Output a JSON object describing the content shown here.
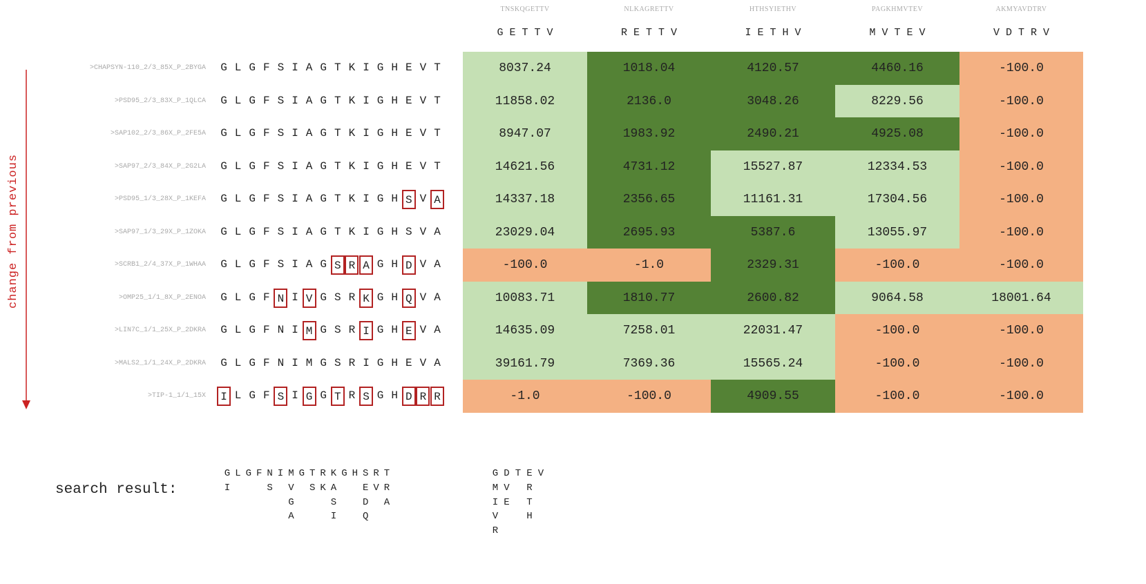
{
  "columns": [
    {
      "peptide": "TNSKQGETTV",
      "short": "G E T T V"
    },
    {
      "peptide": "NLKAGRETTV",
      "short": "R E T T V"
    },
    {
      "peptide": "HTHSYIETHV",
      "short": "I E T H V"
    },
    {
      "peptide": "PAGKHMVTEV",
      "short": "M V T E V"
    },
    {
      "peptide": "AKMYAVDTRV",
      "short": "V D T R V"
    }
  ],
  "rows": [
    {
      "label": ">CHAPSYN-110_2/3_85X_P_2BYGA",
      "sequence": [
        "G",
        "L",
        "G",
        "F",
        "S",
        "I",
        "A",
        "G",
        "T",
        "K",
        "I",
        "G",
        "H",
        "E",
        "V",
        "T"
      ],
      "changed": [],
      "values": [
        "8037.24",
        "1018.04",
        "4120.57",
        "4460.16",
        "-100.0"
      ],
      "classes": [
        "light",
        "dark",
        "dark",
        "dark",
        "neg"
      ]
    },
    {
      "label": ">PSD95_2/3_83X_P_1QLCA",
      "sequence": [
        "G",
        "L",
        "G",
        "F",
        "S",
        "I",
        "A",
        "G",
        "T",
        "K",
        "I",
        "G",
        "H",
        "E",
        "V",
        "T"
      ],
      "changed": [],
      "values": [
        "11858.02",
        "2136.0",
        "3048.26",
        "8229.56",
        "-100.0"
      ],
      "classes": [
        "light",
        "dark",
        "dark",
        "light",
        "neg"
      ]
    },
    {
      "label": ">SAP102_2/3_86X_P_2FE5A",
      "sequence": [
        "G",
        "L",
        "G",
        "F",
        "S",
        "I",
        "A",
        "G",
        "T",
        "K",
        "I",
        "G",
        "H",
        "E",
        "V",
        "T"
      ],
      "changed": [],
      "values": [
        "8947.07",
        "1983.92",
        "2490.21",
        "4925.08",
        "-100.0"
      ],
      "classes": [
        "light",
        "dark",
        "dark",
        "dark",
        "neg"
      ]
    },
    {
      "label": ">SAP97_2/3_84X_P_2G2LA",
      "sequence": [
        "G",
        "L",
        "G",
        "F",
        "S",
        "I",
        "A",
        "G",
        "T",
        "K",
        "I",
        "G",
        "H",
        "E",
        "V",
        "T"
      ],
      "changed": [],
      "values": [
        "14621.56",
        "4731.12",
        "15527.87",
        "12334.53",
        "-100.0"
      ],
      "classes": [
        "light",
        "dark",
        "light",
        "light",
        "neg"
      ]
    },
    {
      "label": ">PSD95_1/3_28X_P_1KEFA",
      "sequence": [
        "G",
        "L",
        "G",
        "F",
        "S",
        "I",
        "A",
        "G",
        "T",
        "K",
        "I",
        "G",
        "H",
        "S",
        "V",
        "A"
      ],
      "changed": [
        13,
        15
      ],
      "values": [
        "14337.18",
        "2356.65",
        "11161.31",
        "17304.56",
        "-100.0"
      ],
      "classes": [
        "light",
        "dark",
        "light",
        "light",
        "neg"
      ]
    },
    {
      "label": ">SAP97_1/3_29X_P_1ZOKA",
      "sequence": [
        "G",
        "L",
        "G",
        "F",
        "S",
        "I",
        "A",
        "G",
        "T",
        "K",
        "I",
        "G",
        "H",
        "S",
        "V",
        "A"
      ],
      "changed": [],
      "values": [
        "23029.04",
        "2695.93",
        "5387.6",
        "13055.97",
        "-100.0"
      ],
      "classes": [
        "light",
        "dark",
        "dark",
        "light",
        "neg"
      ]
    },
    {
      "label": ">SCRB1_2/4_37X_P_1WHAA",
      "sequence": [
        "G",
        "L",
        "G",
        "F",
        "S",
        "I",
        "A",
        "G",
        "S",
        "R",
        "A",
        "G",
        "H",
        "D",
        "V",
        "A"
      ],
      "changed": [
        8,
        9,
        10,
        13
      ],
      "values": [
        "-100.0",
        "-1.0",
        "2329.31",
        "-100.0",
        "-100.0"
      ],
      "classes": [
        "neg",
        "neg",
        "dark",
        "neg",
        "neg"
      ]
    },
    {
      "label": ">OMP25_1/1_8X_P_2ENOA",
      "sequence": [
        "G",
        "L",
        "G",
        "F",
        "N",
        "I",
        "V",
        "G",
        "S",
        "R",
        "K",
        "G",
        "H",
        "Q",
        "V",
        "A"
      ],
      "changed": [
        4,
        6,
        10,
        13
      ],
      "values": [
        "10083.71",
        "1810.77",
        "2600.82",
        "9064.58",
        "18001.64"
      ],
      "classes": [
        "light",
        "dark",
        "dark",
        "light",
        "light"
      ]
    },
    {
      "label": ">LIN7C_1/1_25X_P_2DKRA",
      "sequence": [
        "G",
        "L",
        "G",
        "F",
        "N",
        "I",
        "M",
        "G",
        "S",
        "R",
        "I",
        "G",
        "H",
        "E",
        "V",
        "A"
      ],
      "changed": [
        6,
        10,
        13
      ],
      "values": [
        "14635.09",
        "7258.01",
        "22031.47",
        "-100.0",
        "-100.0"
      ],
      "classes": [
        "light",
        "light",
        "light",
        "neg",
        "neg"
      ]
    },
    {
      "label": ">MALS2_1/1_24X_P_2DKRA",
      "sequence": [
        "G",
        "L",
        "G",
        "F",
        "N",
        "I",
        "M",
        "G",
        "S",
        "R",
        "I",
        "G",
        "H",
        "E",
        "V",
        "A"
      ],
      "changed": [],
      "values": [
        "39161.79",
        "7369.36",
        "15565.24",
        "-100.0",
        "-100.0"
      ],
      "classes": [
        "light",
        "light",
        "light",
        "neg",
        "neg"
      ]
    },
    {
      "label": ">TIP-1_1/1_15X",
      "sequence": [
        "I",
        "L",
        "G",
        "F",
        "S",
        "I",
        "G",
        "G",
        "T",
        "R",
        "S",
        "G",
        "H",
        "D",
        "R",
        "R"
      ],
      "changed": [
        0,
        4,
        6,
        8,
        10,
        13,
        14,
        15
      ],
      "values": [
        "-1.0",
        "-100.0",
        "4909.55",
        "-100.0",
        "-100.0"
      ],
      "classes": [
        "neg",
        "neg",
        "dark",
        "neg",
        "neg"
      ]
    }
  ],
  "colors": {
    "light": "#c5e0b4",
    "dark": "#548235",
    "neg": "#f4b183",
    "box": "#b22222",
    "axis": "#cc2222"
  },
  "axis_label": "change from previous",
  "search_label": "search result:",
  "search_domain": [
    [
      "G",
      "I"
    ],
    [
      "L"
    ],
    [
      "G"
    ],
    [
      "F"
    ],
    [
      "N",
      "S"
    ],
    [
      "I"
    ],
    [
      "M",
      "V",
      "G",
      "A"
    ],
    [
      "G"
    ],
    [
      "T",
      "S"
    ],
    [
      "R",
      "K"
    ],
    [
      "K",
      "A",
      "S",
      "I"
    ],
    [
      "G"
    ],
    [
      "H"
    ],
    [
      "S",
      "E",
      "D",
      "Q"
    ],
    [
      "R",
      "V"
    ],
    [
      "T",
      "R",
      "A"
    ]
  ],
  "search_peptide": [
    [
      "G",
      "M",
      "I",
      "V",
      "R"
    ],
    [
      "D",
      "V",
      "E"
    ],
    [
      "T"
    ],
    [
      "E",
      "R",
      "T",
      "H"
    ],
    [
      "V"
    ]
  ],
  "chart_data": {
    "type": "heatmap",
    "x": [
      "TNSKQGETTV",
      "NLKAGRETTV",
      "HTHSYIETHV",
      "PAGKHMVTEV",
      "AKMYAVDTRV"
    ],
    "y": [
      ">CHAPSYN-110_2/3_85X_P_2BYGA",
      ">PSD95_2/3_83X_P_1QLCA",
      ">SAP102_2/3_86X_P_2FE5A",
      ">SAP97_2/3_84X_P_2G2LA",
      ">PSD95_1/3_28X_P_1KEFA",
      ">SAP97_1/3_29X_P_1ZOKA",
      ">SCRB1_2/4_37X_P_1WHAA",
      ">OMP25_1/1_8X_P_2ENOA",
      ">LIN7C_1/1_25X_P_2DKRA",
      ">MALS2_1/1_24X_P_2DKRA",
      ">TIP-1_1/1_15X"
    ],
    "values": [
      [
        8037.24,
        1018.04,
        4120.57,
        4460.16,
        -100.0
      ],
      [
        11858.02,
        2136.0,
        3048.26,
        8229.56,
        -100.0
      ],
      [
        8947.07,
        1983.92,
        2490.21,
        4925.08,
        -100.0
      ],
      [
        14621.56,
        4731.12,
        15527.87,
        12334.53,
        -100.0
      ],
      [
        14337.18,
        2356.65,
        11161.31,
        17304.56,
        -100.0
      ],
      [
        23029.04,
        2695.93,
        5387.6,
        13055.97,
        -100.0
      ],
      [
        -100.0,
        -1.0,
        2329.31,
        -100.0,
        -100.0
      ],
      [
        10083.71,
        1810.77,
        2600.82,
        9064.58,
        18001.64
      ],
      [
        14635.09,
        7258.01,
        22031.47,
        -100.0,
        -100.0
      ],
      [
        39161.79,
        7369.36,
        15565.24,
        -100.0,
        -100.0
      ],
      [
        -1.0,
        -100.0,
        4909.55,
        -100.0,
        -100.0
      ]
    ]
  }
}
